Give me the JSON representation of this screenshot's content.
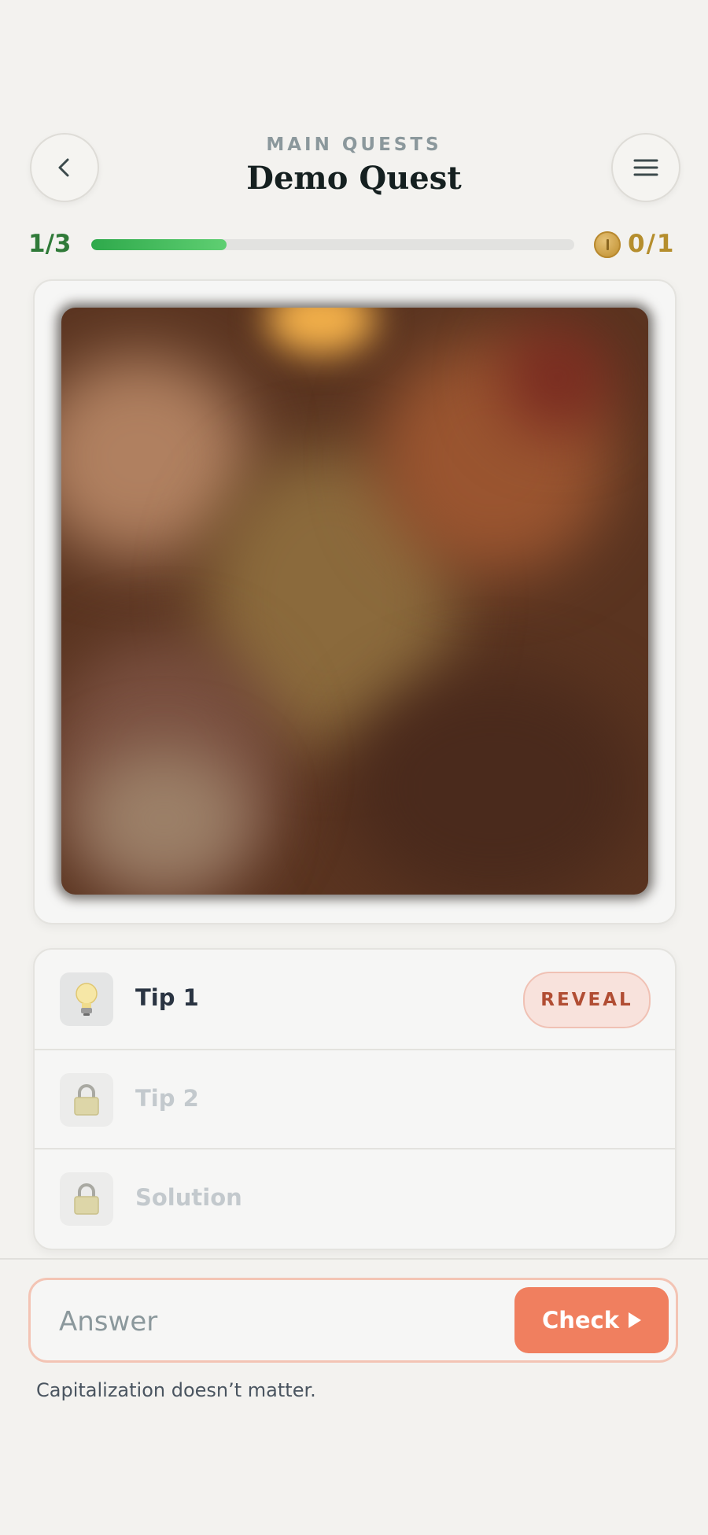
{
  "header": {
    "subtitle": "MAIN QUESTS",
    "title": "Demo Quest",
    "back_icon": "chevron-left-icon",
    "menu_icon": "hamburger-menu-icon"
  },
  "progress": {
    "count_label": "1/3",
    "fraction": 0.28,
    "fill_colors": [
      "#2ea94b",
      "#5fcf72"
    ]
  },
  "coins": {
    "icon": "coin-icon",
    "label": "0/1"
  },
  "tips": [
    {
      "label": "Tip 1",
      "icon": "lightbulb-icon",
      "locked": false,
      "action": "REVEAL"
    },
    {
      "label": "Tip 2",
      "icon": "lock-icon",
      "locked": true
    },
    {
      "label": "Solution",
      "icon": "lock-icon",
      "locked": true
    }
  ],
  "answer": {
    "placeholder": "Answer",
    "check_label": "Check",
    "hint": "Capitalization doesn’t matter."
  },
  "colors": {
    "accent": "#f07f5f",
    "progress_green": "#2ea94b",
    "coin_gold": "#b58e2d"
  }
}
